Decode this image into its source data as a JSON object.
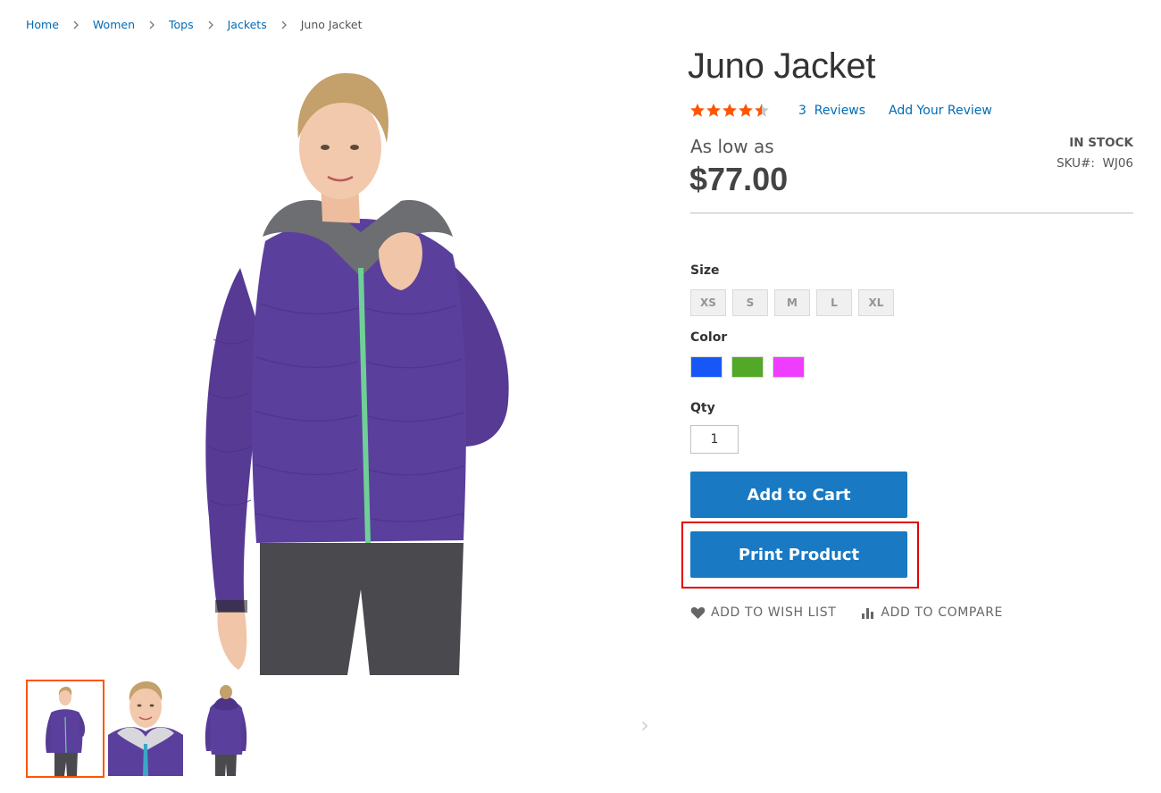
{
  "breadcrumb": {
    "items": [
      "Home",
      "Women",
      "Tops",
      "Jackets"
    ],
    "current": "Juno Jacket"
  },
  "product": {
    "name": "Juno Jacket",
    "rating_stars": 4.5,
    "reviews_link": "3  Reviews",
    "add_review_link": "Add Your Review",
    "price_prefix": "As low as",
    "price": "$77.00",
    "stock": "IN STOCK",
    "sku_label": "SKU#:",
    "sku_value": "WJ06"
  },
  "options": {
    "size_label": "Size",
    "sizes": [
      "XS",
      "S",
      "M",
      "L",
      "XL"
    ],
    "color_label": "Color",
    "colors": [
      "#1857f7",
      "#53a828",
      "#ef3dff"
    ],
    "qty_label": "Qty",
    "qty_value": "1"
  },
  "buttons": {
    "add_to_cart": "Add to Cart",
    "print_product": "Print Product",
    "wish_list": "ADD TO WISH LIST",
    "compare": "ADD TO COMPARE"
  },
  "gallery": {
    "jacket_color": "#5b3f9c",
    "accent_color": "#ff5501",
    "next_arrow": "›"
  }
}
